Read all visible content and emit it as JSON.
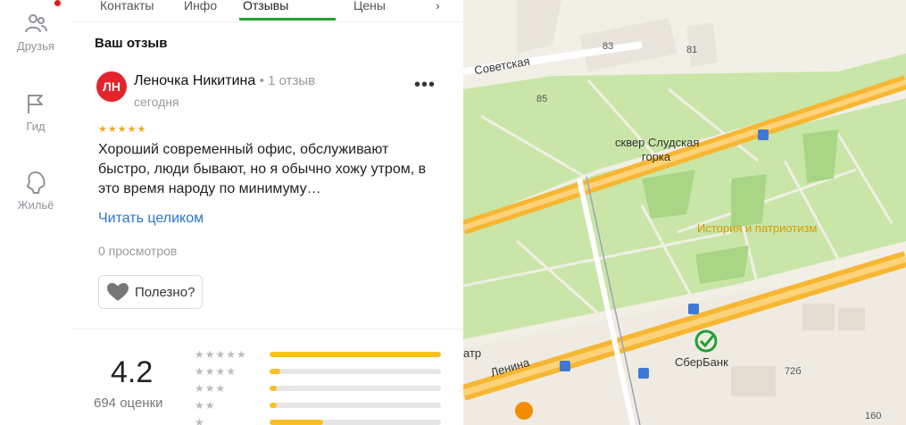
{
  "rail": {
    "items": [
      {
        "label": "Друзья",
        "icon": "friends-icon"
      },
      {
        "label": "Гид",
        "icon": "flag-icon"
      },
      {
        "label": "Жильё",
        "icon": "home-icon"
      }
    ]
  },
  "tabs": {
    "items": [
      "Контакты",
      "Инфо",
      "Отзывы",
      "Цены"
    ],
    "active": "Отзывы"
  },
  "review": {
    "section_title": "Ваш отзыв",
    "avatar_initials": "ЛН",
    "author": "Леночка Никитина",
    "author_reviews": "1 отзыв",
    "date": "сегодня",
    "more": "•••",
    "rating": 5,
    "text": "Хороший современный офис, обслуживают быстро, люди бывают, но я обычно хожу утром, в это время народу по минимуму…",
    "read_more": "Читать целиком",
    "views": "0 просмотров",
    "useful": "Полезно?"
  },
  "summary": {
    "rating": "4.2",
    "count": "694 оценки",
    "distribution": [
      {
        "stars": 5,
        "fraction": 1.0
      },
      {
        "stars": 4,
        "fraction": 0.06
      },
      {
        "stars": 3,
        "fraction": 0.04
      },
      {
        "stars": 2,
        "fraction": 0.04
      },
      {
        "stars": 1,
        "fraction": 0.31
      }
    ]
  },
  "map": {
    "labels": {
      "street1": "Советская",
      "park": "сквер Слудская",
      "park2": "горка",
      "poi": "История и патриотизм",
      "bank": "СберБанк",
      "street2": "Ленина",
      "theater": "атр"
    },
    "numbers": [
      "83",
      "81",
      "85",
      "72б",
      "160"
    ],
    "colors": {
      "park": "#c9e6a8",
      "road": "#f7b733",
      "poi_text": "#d99a00"
    }
  }
}
